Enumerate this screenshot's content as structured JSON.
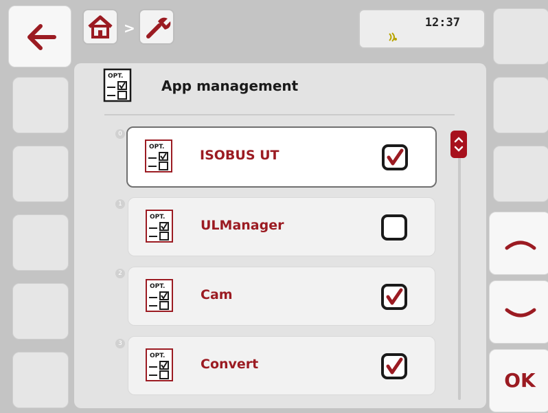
{
  "header": {
    "title": "App management",
    "breadcrumb_sep": ">",
    "time": "12:37",
    "breadcrumb_icons": [
      "home-icon",
      "wrench-icon"
    ]
  },
  "list": {
    "items": [
      {
        "index": "0",
        "label": "ISOBUS UT",
        "checked": true,
        "icon": "opt-icon"
      },
      {
        "index": "1",
        "label": "ULManager",
        "checked": false,
        "icon": "opt-icon"
      },
      {
        "index": "2",
        "label": "Cam",
        "checked": true,
        "icon": "opt-icon"
      },
      {
        "index": "3",
        "label": "Convert",
        "checked": true,
        "icon": "opt-icon"
      }
    ]
  },
  "buttons": {
    "ok_label": "OK",
    "opt_text": "OPT."
  },
  "colors": {
    "accent": "#9b1b22",
    "scroll": "#a7111d",
    "signal": "#b8a400"
  }
}
